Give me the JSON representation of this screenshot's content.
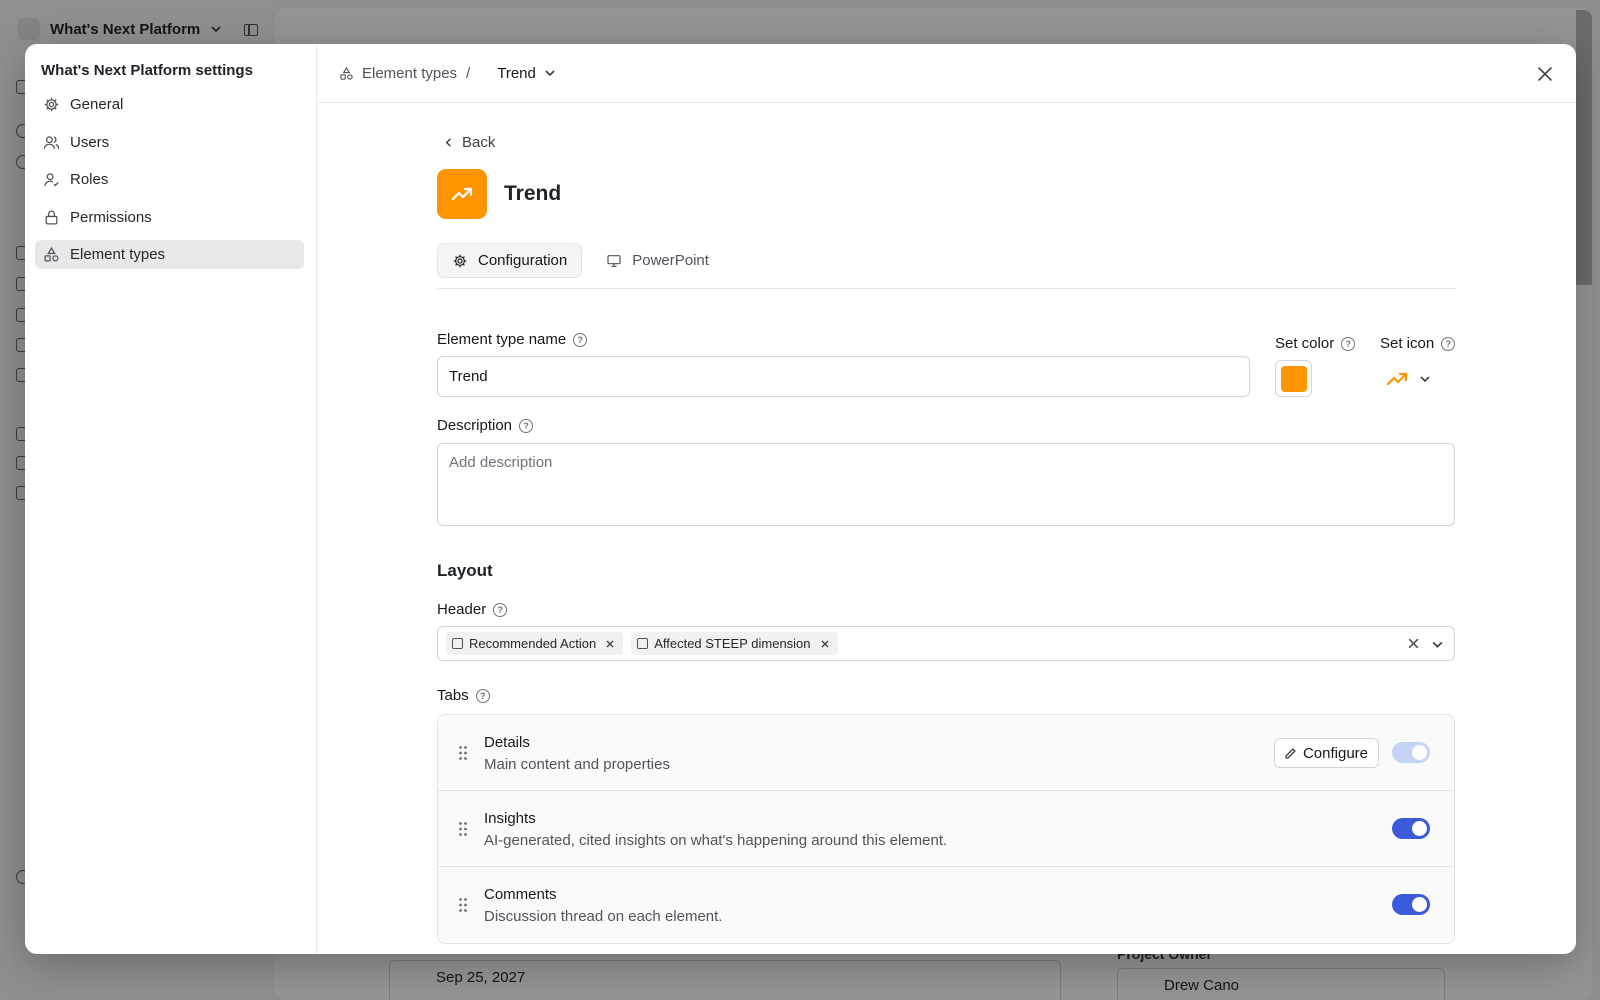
{
  "background": {
    "app_title": "What's Next Platform",
    "date_value": "Sep 25, 2027",
    "owner_label": "Project Owner",
    "owner_value": "Drew Cano"
  },
  "settings_nav": {
    "title": "What's Next Platform settings",
    "items": [
      {
        "label": "General",
        "icon": "gear-icon"
      },
      {
        "label": "Users",
        "icon": "users-icon"
      },
      {
        "label": "Roles",
        "icon": "user-check-icon"
      },
      {
        "label": "Permissions",
        "icon": "lock-icon"
      },
      {
        "label": "Element types",
        "icon": "shapes-icon",
        "active": true
      }
    ]
  },
  "breadcrumb": {
    "parent": "Element types",
    "separator": "/",
    "current": "Trend"
  },
  "page": {
    "back_label": "Back",
    "title": "Trend",
    "icon": "trending-up-icon",
    "accent_color": "#ff9500",
    "tabs": [
      {
        "label": "Configuration",
        "icon": "gear-icon",
        "active": true
      },
      {
        "label": "PowerPoint",
        "icon": "presentation-icon",
        "active": false
      }
    ]
  },
  "form": {
    "name_label": "Element type name",
    "name_value": "Trend",
    "color_label": "Set color",
    "color_value": "#ff9500",
    "icon_label": "Set icon",
    "description_label": "Description",
    "description_placeholder": "Add description",
    "layout_title": "Layout",
    "header_label": "Header",
    "header_chips": [
      "Recommended Action",
      "Affected STEEP dimension"
    ],
    "tabs_label": "Tabs",
    "tab_rows": [
      {
        "title": "Details",
        "description": "Main content and properties",
        "configure_label": "Configure",
        "enabled": true,
        "locked": true
      },
      {
        "title": "Insights",
        "description": "AI-generated, cited insights on what's happening around this element.",
        "enabled": true,
        "locked": false
      },
      {
        "title": "Comments",
        "description": "Discussion thread on each element.",
        "enabled": true,
        "locked": false
      }
    ]
  },
  "colors": {
    "toggle_on": "#3b5bdb",
    "toggle_locked": "#c5d3f5"
  }
}
